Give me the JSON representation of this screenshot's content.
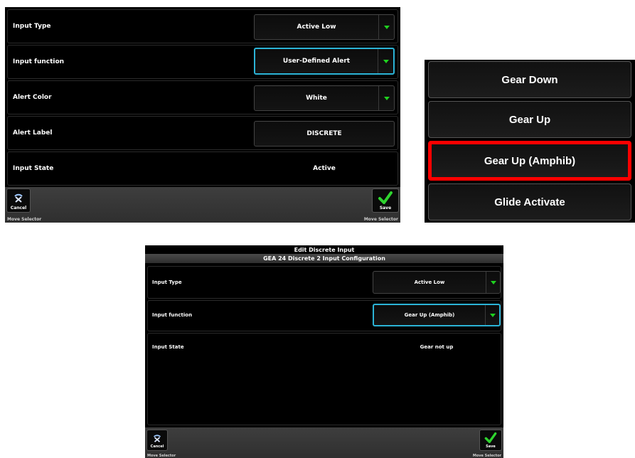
{
  "top_left": {
    "rows": [
      {
        "label": "Input Type",
        "value": "Active Low",
        "kind": "dropdown"
      },
      {
        "label": "Input function",
        "value": "User-Defined Alert",
        "kind": "dropdown-selected"
      },
      {
        "label": "Alert Color",
        "value": "White",
        "kind": "dropdown"
      },
      {
        "label": "Alert Label",
        "value": "DISCRETE",
        "kind": "button"
      },
      {
        "label": "Input State",
        "value": "Active",
        "kind": "text"
      }
    ],
    "cancel_label": "Cancel",
    "save_label": "Save",
    "hint_left": "Move Selector",
    "hint_right": "Move Selector"
  },
  "list": {
    "items": [
      "Gear Down",
      "Gear Up",
      "Gear Up (Amphib)",
      "Glide Activate"
    ],
    "highlighted_index": 2,
    "highlight_color": "#ff0000"
  },
  "bottom": {
    "window_title": "Edit Discrete Input",
    "section_title": "GEA 24 Discrete 2 Input Configuration",
    "rows": [
      {
        "label": "Input Type",
        "value": "Active Low",
        "kind": "dropdown"
      },
      {
        "label": "Input function",
        "value": "Gear Up (Amphib)",
        "kind": "dropdown-selected"
      },
      {
        "label": "Input State",
        "value": "Gear not up",
        "kind": "text"
      }
    ],
    "cancel_label": "Cancel",
    "save_label": "Save",
    "hint_left": "Move Selector",
    "hint_right": "Move Selector"
  },
  "colors": {
    "accent_selected": "#2bb3d6",
    "dropdown_arrow": "#1fd11f",
    "save_check": "#2fd42f"
  },
  "icons": [
    "cancel-icon",
    "save-check-icon",
    "dropdown-arrow-icon"
  ]
}
